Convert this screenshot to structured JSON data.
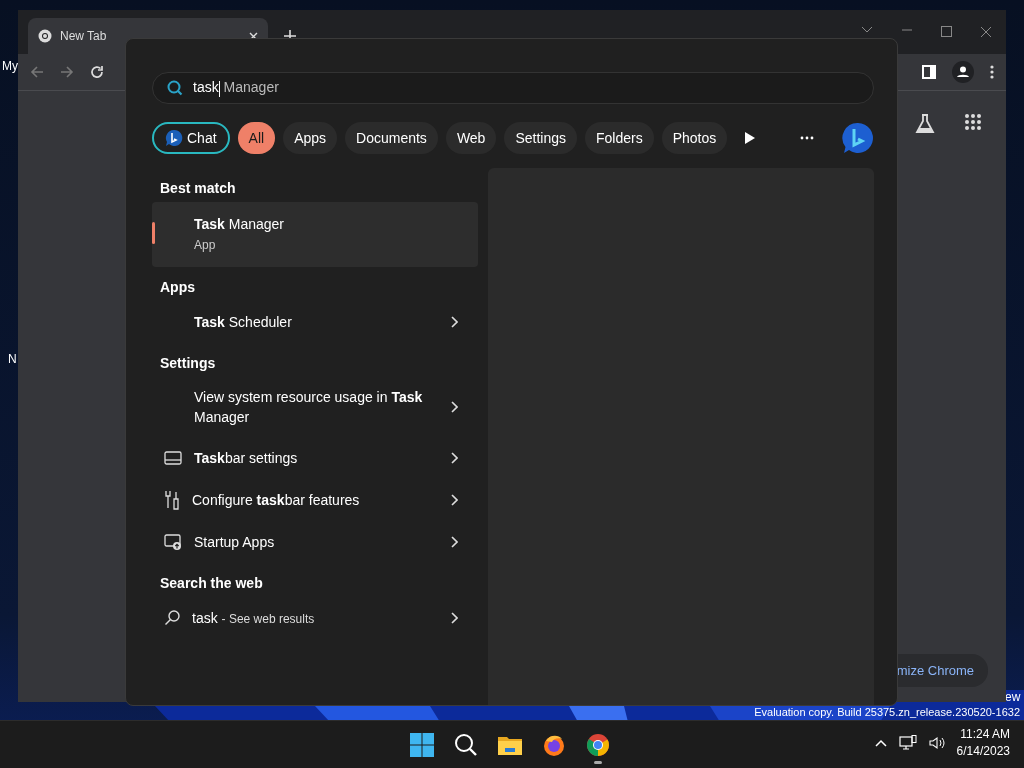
{
  "desktop": {
    "labels": [
      "My",
      "N"
    ],
    "edge_text": "ew",
    "build_text": "Evaluation copy. Build 25375.zn_release.230520-1632"
  },
  "browser": {
    "tab": {
      "title": "New Tab"
    },
    "customize_button": "mize Chrome"
  },
  "search_flyout": {
    "search": {
      "value": "task",
      "suggestion": "Manager"
    },
    "filters": [
      {
        "label": "Chat",
        "kind": "chat",
        "selected": false
      },
      {
        "label": "All",
        "kind": "chip",
        "selected": true
      },
      {
        "label": "Apps",
        "kind": "chip",
        "selected": false
      },
      {
        "label": "Documents",
        "kind": "chip",
        "selected": false
      },
      {
        "label": "Web",
        "kind": "chip",
        "selected": false
      },
      {
        "label": "Settings",
        "kind": "chip",
        "selected": false
      },
      {
        "label": "Folders",
        "kind": "chip",
        "selected": false
      },
      {
        "label": "Photos",
        "kind": "chip",
        "selected": false
      }
    ],
    "sections": [
      {
        "title": "Best match",
        "items": [
          {
            "text": "**Task** Manager",
            "subtitle": "App",
            "kind": "blank",
            "selected": true,
            "chevron": false
          }
        ]
      },
      {
        "title": "Apps",
        "items": [
          {
            "text": "**Task** Scheduler",
            "kind": "blank",
            "selected": false,
            "chevron": true
          }
        ]
      },
      {
        "title": "Settings",
        "items": [
          {
            "text": "View system resource usage in **Task** Manager",
            "kind": "blank",
            "selected": false,
            "chevron": true
          },
          {
            "text": "**Task**bar settings",
            "kind": "taskbar",
            "selected": false,
            "chevron": true
          },
          {
            "text": "Configure **task**bar features",
            "kind": "tools",
            "selected": false,
            "chevron": true
          },
          {
            "text": "Startup Apps",
            "kind": "startup",
            "selected": false,
            "chevron": true
          }
        ]
      },
      {
        "title": "Search the web",
        "items": [
          {
            "text": "task",
            "suffix": "- See web results",
            "kind": "search",
            "selected": false,
            "chevron": true
          }
        ]
      }
    ]
  },
  "taskbar": {
    "apps": [
      {
        "kind": "start",
        "selected": false
      },
      {
        "kind": "search",
        "selected": false
      },
      {
        "kind": "explorer",
        "selected": false
      },
      {
        "kind": "firefox",
        "selected": false
      },
      {
        "kind": "chrome",
        "selected": true
      }
    ],
    "time": "11:24 AM",
    "date": "6/14/2023"
  }
}
